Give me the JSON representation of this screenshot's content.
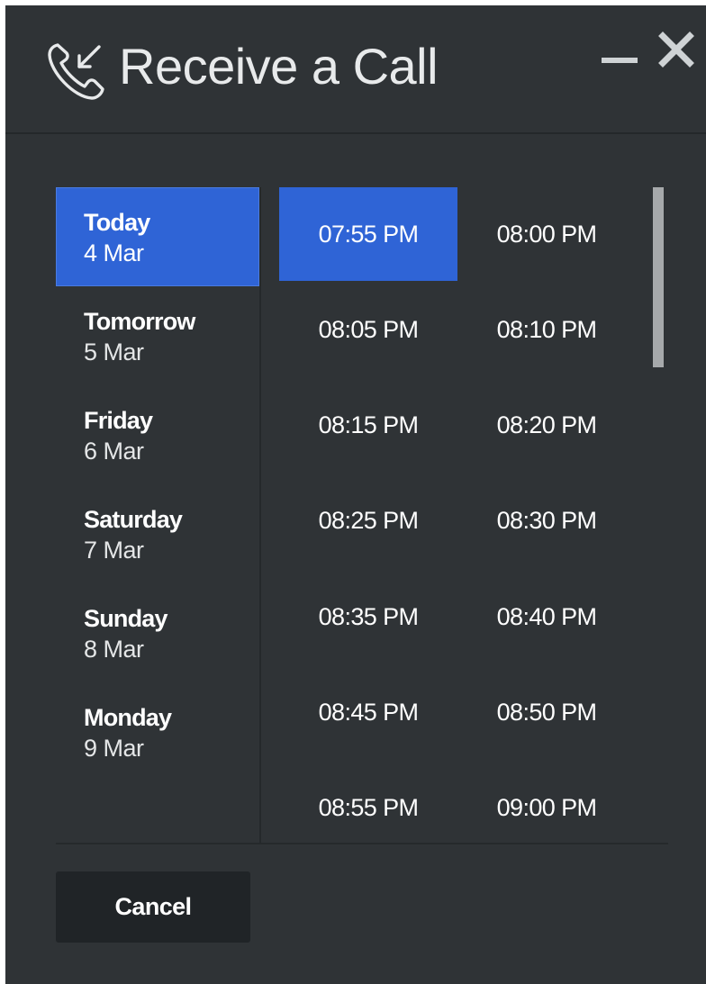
{
  "dialog": {
    "title": "Receive a Call",
    "header_icon": "phone-incoming-icon",
    "minimize_icon": "minimize-icon",
    "close_icon": "close-icon"
  },
  "days": [
    {
      "name": "Today",
      "date": "4 Mar",
      "selected": true
    },
    {
      "name": "Tomorrow",
      "date": "5 Mar",
      "selected": false
    },
    {
      "name": "Friday",
      "date": "6 Mar",
      "selected": false
    },
    {
      "name": "Saturday",
      "date": "7 Mar",
      "selected": false
    },
    {
      "name": "Sunday",
      "date": "8 Mar",
      "selected": false
    },
    {
      "name": "Monday",
      "date": "9 Mar",
      "selected": false
    }
  ],
  "times": [
    {
      "label": "07:55 PM",
      "selected": true
    },
    {
      "label": "08:00 PM",
      "selected": false
    },
    {
      "label": "08:05 PM",
      "selected": false
    },
    {
      "label": "08:10 PM",
      "selected": false
    },
    {
      "label": "08:15 PM",
      "selected": false
    },
    {
      "label": "08:20 PM",
      "selected": false
    },
    {
      "label": "08:25 PM",
      "selected": false
    },
    {
      "label": "08:30 PM",
      "selected": false
    },
    {
      "label": "08:35 PM",
      "selected": false
    },
    {
      "label": "08:40 PM",
      "selected": false
    },
    {
      "label": "08:45 PM",
      "selected": false
    },
    {
      "label": "08:50 PM",
      "selected": false
    },
    {
      "label": "08:55 PM",
      "selected": false
    },
    {
      "label": "09:00 PM",
      "selected": false
    }
  ],
  "footer": {
    "cancel_label": "Cancel"
  },
  "colors": {
    "background": "#2f3336",
    "accent": "#2f64d6",
    "button": "#202427",
    "text": "#ffffff"
  }
}
